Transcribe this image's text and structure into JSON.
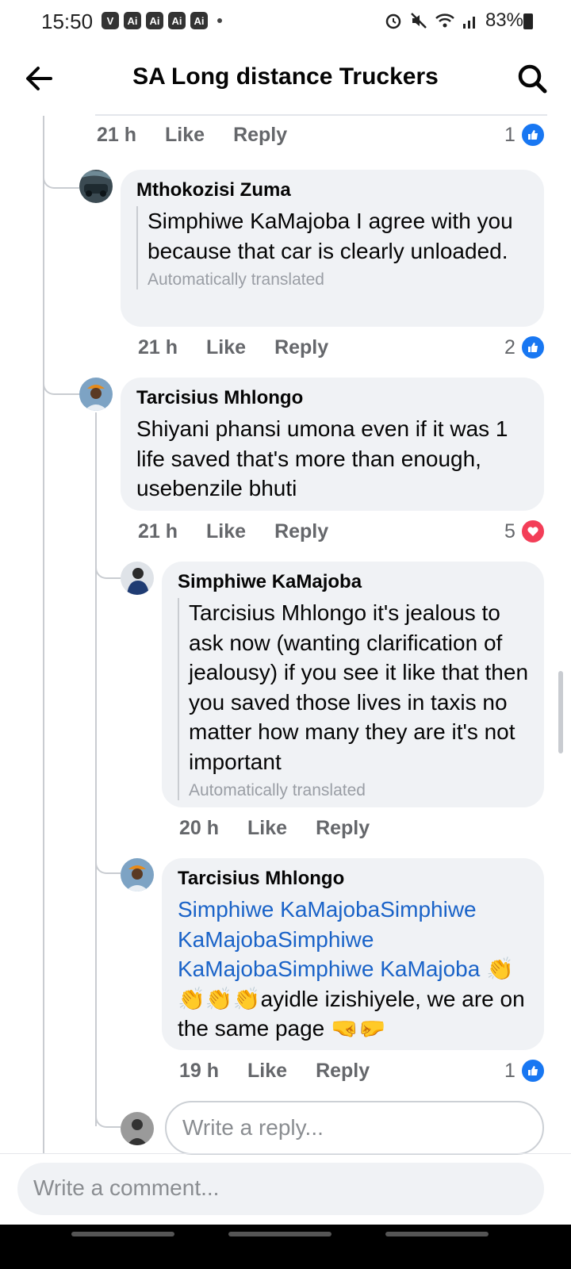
{
  "status_bar": {
    "time": "15:50",
    "app_icons": [
      "Ai",
      "Ai",
      "Ai",
      "Ai"
    ],
    "battery": "83%"
  },
  "header": {
    "title": "SA Long distance Truckers"
  },
  "top_meta": {
    "time": "21 h",
    "like": "Like",
    "reply": "Reply",
    "count": "1"
  },
  "comments": [
    {
      "author": "Mthokozisi Zuma",
      "text": "Simphiwe KaMajoba I agree with you because that car is clearly unloaded.",
      "note": "Automatically translated",
      "time": "21 h",
      "like": "Like",
      "reply": "Reply",
      "reaction_count": "2",
      "reaction": "like"
    },
    {
      "author": "Tarcisius Mhlongo",
      "text": "Shiyani phansi umona even if it was 1 life saved that's more than enough, usebenzile bhuti",
      "time": "21 h",
      "like": "Like",
      "reply": "Reply",
      "reaction_count": "5",
      "reaction": "love"
    },
    {
      "author": "Simphiwe KaMajoba",
      "text": "Tarcisius Mhlongo it's jealous to ask now (wanting clarification of jealousy) if you see it like that then you saved those lives in taxis no matter how many they are it's not important",
      "note": "Automatically translated",
      "time": "20 h",
      "like": "Like",
      "reply": "Reply"
    },
    {
      "author": "Tarcisius Mhlongo",
      "mention": "Simphiwe KaMajobaSimphiwe KaMajobaSimphiwe KaMajobaSimphiwe KaMajoba",
      "text": "👏👏👏👏ayidle izishiyele, we are on the same page 🤜🤛",
      "time": "19 h",
      "like": "Like",
      "reply": "Reply",
      "reaction_count": "1",
      "reaction": "like"
    }
  ],
  "reply_placeholder": "Write a reply...",
  "comment_placeholder": "Write a comment..."
}
